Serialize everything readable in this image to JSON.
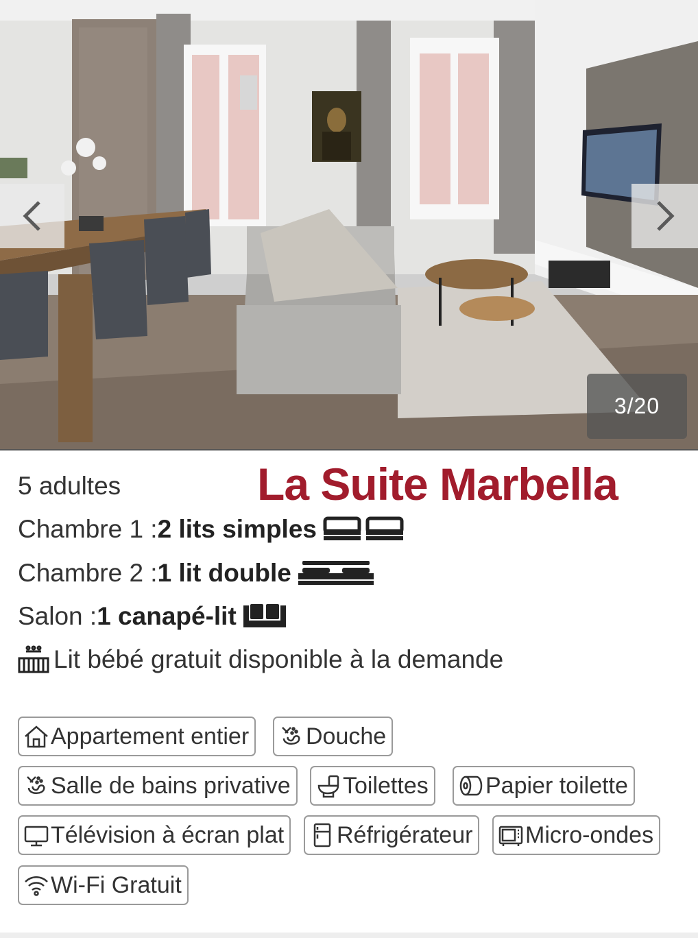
{
  "gallery": {
    "prev_icon": "chevron-left-icon",
    "next_icon": "chevron-right-icon",
    "counter": "3/20"
  },
  "listing": {
    "title": "La Suite Marbella",
    "title_color": "#a11c2c",
    "capacity": "5 adultes",
    "rooms": [
      {
        "label": "Chambre 1 : ",
        "detail": "2 lits simples",
        "icon": "single-bed-icon"
      },
      {
        "label": "Chambre 2 : ",
        "detail": "1 lit double",
        "icon": "double-bed-icon"
      },
      {
        "label": "Salon : ",
        "detail": "1 canapé-lit",
        "icon": "sofa-bed-icon"
      }
    ],
    "crib": {
      "icon": "crib-icon",
      "text": "Lit bébé gratuit disponible à la demande"
    }
  },
  "amenities": [
    {
      "icon": "house-icon",
      "label": "Appartement entier"
    },
    {
      "icon": "shower-icon",
      "label": "Douche"
    },
    {
      "icon": "bath-icon",
      "label": "Salle de bains privative"
    },
    {
      "icon": "toilet-icon",
      "label": "Toilettes"
    },
    {
      "icon": "toilet-paper-icon",
      "label": "Papier toilette"
    },
    {
      "icon": "tv-icon",
      "label": "Télévision à écran plat"
    },
    {
      "icon": "fridge-icon",
      "label": "Réfrigérateur"
    },
    {
      "icon": "microwave-icon",
      "label": "Micro-ondes"
    },
    {
      "icon": "wifi-icon",
      "label": "Wi-Fi Gratuit"
    }
  ]
}
